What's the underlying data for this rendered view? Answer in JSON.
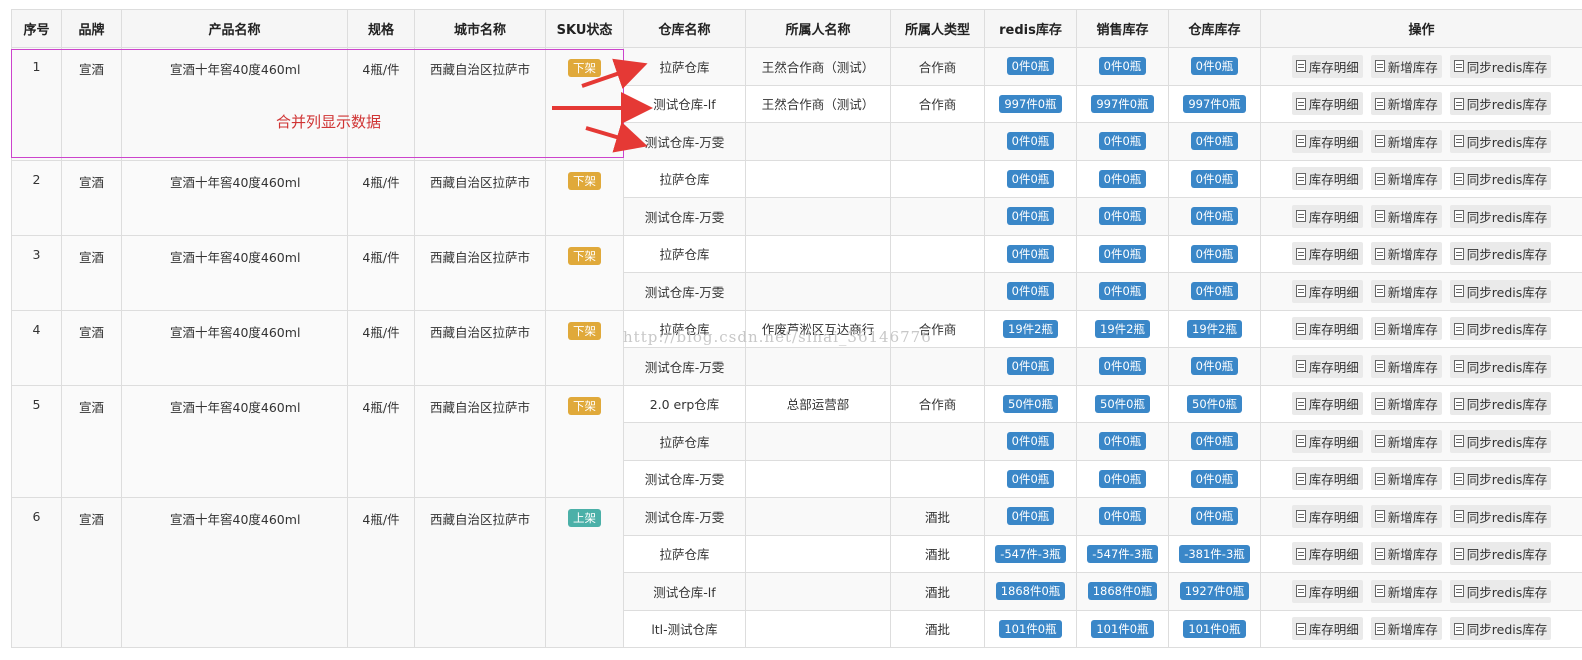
{
  "headers": [
    "序号",
    "品牌",
    "产品名称",
    "规格",
    "城市名称",
    "SKU状态",
    "仓库名称",
    "所属人名称",
    "所属人类型",
    "redis库存",
    "销售库存",
    "仓库库存",
    "操作"
  ],
  "actions": [
    "库存明细",
    "新增库存",
    "同步redis库存"
  ],
  "annotation": {
    "merge_label": "合并列显示数据",
    "watermark": "http://blog.csdn.net/sihai_36146776"
  },
  "colors": {
    "stock_badge": "#3a87c8",
    "status_down": "#e0a93a",
    "status_up": "#4bb0a8",
    "highlight_box": "#cc44cc",
    "arrow": "#e53935"
  },
  "groups": [
    {
      "no": "1",
      "brand": "宣酒",
      "product": "宣酒十年窖40度460ml",
      "spec": "4瓶/件",
      "city": "西藏自治区拉萨市",
      "status": "下架",
      "status_kind": "down",
      "rows": [
        {
          "warehouse": "拉萨仓库",
          "owner": "王然合作商（测试）",
          "owner_type": "合作商",
          "redis": "0件0瓶",
          "sale": "0件0瓶",
          "wh_stock": "0件0瓶"
        },
        {
          "warehouse": "测试仓库-lf",
          "owner": "王然合作商（测试）",
          "owner_type": "合作商",
          "redis": "997件0瓶",
          "sale": "997件0瓶",
          "wh_stock": "997件0瓶"
        },
        {
          "warehouse": "测试仓库-万雯",
          "owner": "",
          "owner_type": "",
          "redis": "0件0瓶",
          "sale": "0件0瓶",
          "wh_stock": "0件0瓶"
        }
      ]
    },
    {
      "no": "2",
      "brand": "宣酒",
      "product": "宣酒十年窖40度460ml",
      "spec": "4瓶/件",
      "city": "西藏自治区拉萨市",
      "status": "下架",
      "status_kind": "down",
      "rows": [
        {
          "warehouse": "拉萨仓库",
          "owner": "",
          "owner_type": "",
          "redis": "0件0瓶",
          "sale": "0件0瓶",
          "wh_stock": "0件0瓶"
        },
        {
          "warehouse": "测试仓库-万雯",
          "owner": "",
          "owner_type": "",
          "redis": "0件0瓶",
          "sale": "0件0瓶",
          "wh_stock": "0件0瓶"
        }
      ]
    },
    {
      "no": "3",
      "brand": "宣酒",
      "product": "宣酒十年窖40度460ml",
      "spec": "4瓶/件",
      "city": "西藏自治区拉萨市",
      "status": "下架",
      "status_kind": "down",
      "rows": [
        {
          "warehouse": "拉萨仓库",
          "owner": "",
          "owner_type": "",
          "redis": "0件0瓶",
          "sale": "0件0瓶",
          "wh_stock": "0件0瓶"
        },
        {
          "warehouse": "测试仓库-万雯",
          "owner": "",
          "owner_type": "",
          "redis": "0件0瓶",
          "sale": "0件0瓶",
          "wh_stock": "0件0瓶"
        }
      ]
    },
    {
      "no": "4",
      "brand": "宣酒",
      "product": "宣酒十年窖40度460ml",
      "spec": "4瓶/件",
      "city": "西藏自治区拉萨市",
      "status": "下架",
      "status_kind": "down",
      "rows": [
        {
          "warehouse": "拉萨仓库",
          "owner": "作废芦淞区互达商行",
          "owner_type": "合作商",
          "redis": "19件2瓶",
          "sale": "19件2瓶",
          "wh_stock": "19件2瓶"
        },
        {
          "warehouse": "测试仓库-万雯",
          "owner": "",
          "owner_type": "",
          "redis": "0件0瓶",
          "sale": "0件0瓶",
          "wh_stock": "0件0瓶"
        }
      ]
    },
    {
      "no": "5",
      "brand": "宣酒",
      "product": "宣酒十年窖40度460ml",
      "spec": "4瓶/件",
      "city": "西藏自治区拉萨市",
      "status": "下架",
      "status_kind": "down",
      "rows": [
        {
          "warehouse": "2.0 erp仓库",
          "owner": "总部运营部",
          "owner_type": "合作商",
          "redis": "50件0瓶",
          "sale": "50件0瓶",
          "wh_stock": "50件0瓶"
        },
        {
          "warehouse": "拉萨仓库",
          "owner": "",
          "owner_type": "",
          "redis": "0件0瓶",
          "sale": "0件0瓶",
          "wh_stock": "0件0瓶"
        },
        {
          "warehouse": "测试仓库-万雯",
          "owner": "",
          "owner_type": "",
          "redis": "0件0瓶",
          "sale": "0件0瓶",
          "wh_stock": "0件0瓶"
        }
      ]
    },
    {
      "no": "6",
      "brand": "宣酒",
      "product": "宣酒十年窖40度460ml",
      "spec": "4瓶/件",
      "city": "西藏自治区拉萨市",
      "status": "上架",
      "status_kind": "up",
      "rows": [
        {
          "warehouse": "测试仓库-万雯",
          "owner": "",
          "owner_type": "酒批",
          "redis": "0件0瓶",
          "sale": "0件0瓶",
          "wh_stock": "0件0瓶"
        },
        {
          "warehouse": "拉萨仓库",
          "owner": "",
          "owner_type": "酒批",
          "redis": "-547件-3瓶",
          "sale": "-547件-3瓶",
          "wh_stock": "-381件-3瓶"
        },
        {
          "warehouse": "测试仓库-lf",
          "owner": "",
          "owner_type": "酒批",
          "redis": "1868件0瓶",
          "sale": "1868件0瓶",
          "wh_stock": "1927件0瓶"
        },
        {
          "warehouse": "ltl-测试仓库",
          "owner": "",
          "owner_type": "酒批",
          "redis": "101件0瓶",
          "sale": "101件0瓶",
          "wh_stock": "101件0瓶"
        }
      ]
    }
  ]
}
